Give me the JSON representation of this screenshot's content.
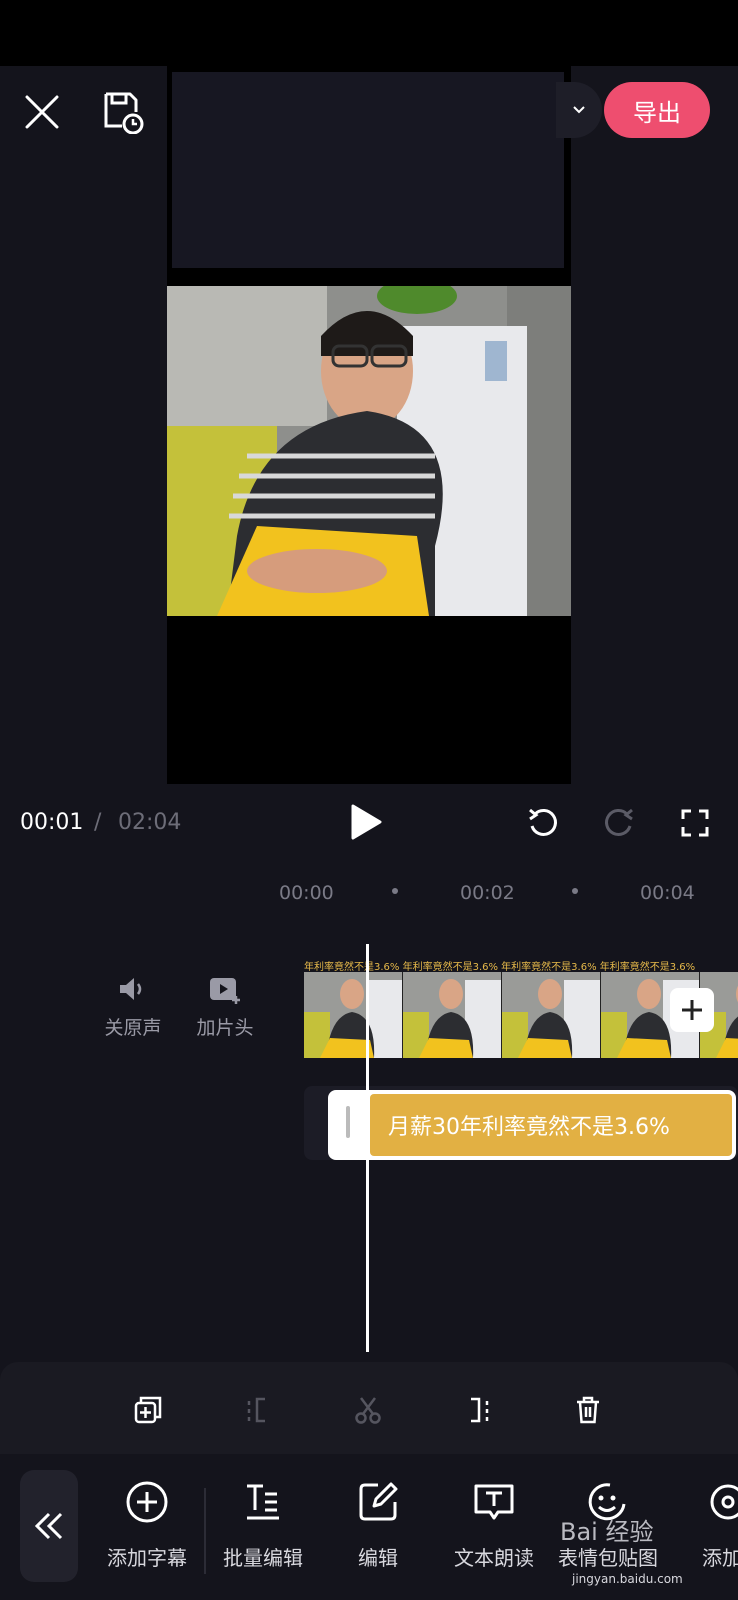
{
  "header": {
    "export_label": "导出"
  },
  "playback": {
    "current_time": "00:01",
    "separator": "/",
    "total_time": "02:04"
  },
  "ruler": {
    "ticks": [
      "00:00",
      "00:02",
      "00:04"
    ]
  },
  "side_tools": {
    "mute_label": "关原声",
    "intro_label": "加片头"
  },
  "timeline": {
    "caption_strip_text": "年利率竟然不是3.6%  年利率竟然不是3.6%  年利率竟然不是3.6%  年利率竟然不是3.6%",
    "subtitle_text": "月薪30年利率竟然不是3.6%"
  },
  "bottom_tools": {
    "items": [
      {
        "label": "添加字幕",
        "icon": "plus-circle-icon"
      },
      {
        "label": "批量编辑",
        "icon": "batch-edit-icon"
      },
      {
        "label": "编辑",
        "icon": "edit-icon"
      },
      {
        "label": "文本朗读",
        "icon": "text-to-speech-icon"
      },
      {
        "label": "表情包贴图",
        "icon": "sticker-icon"
      },
      {
        "label": "添加",
        "icon": "add-icon"
      }
    ]
  },
  "watermark": {
    "text": "Bai 经验",
    "url": "jingyan.baidu.com"
  },
  "colors": {
    "background": "#14141c",
    "accent": "#ee4e6f",
    "subtitle_clip": "#e2b043"
  }
}
